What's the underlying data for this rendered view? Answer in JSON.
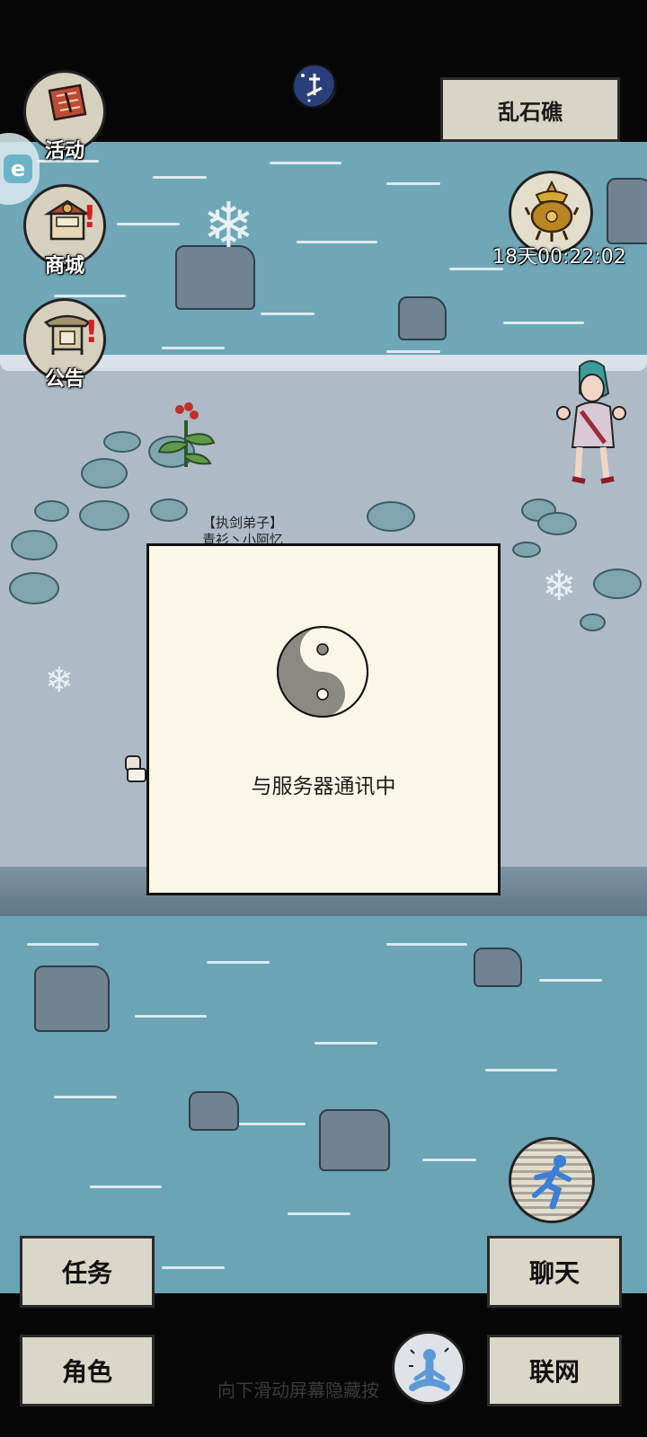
{
  "location": {
    "label": "乱石礁"
  },
  "side_menu": [
    {
      "label": "活动",
      "icon": "scroll-icon",
      "alert": false
    },
    {
      "label": "商城",
      "icon": "shop-icon",
      "alert": true
    },
    {
      "label": "公告",
      "icon": "notice-board-icon",
      "alert": true
    }
  ],
  "event": {
    "icon": "golden-censer-icon",
    "countdown": "18天00:22:02"
  },
  "npc": {
    "title": "【执剑弟子】",
    "name": "青衫丶小阿忆"
  },
  "modal": {
    "icon": "yin-yang-icon",
    "message": "与服务器通讯中"
  },
  "buttons": {
    "task": "任务",
    "chat": "聊天",
    "role": "角色",
    "network": "联网"
  },
  "hint": "向下滑动屏幕隐藏按",
  "colors": {
    "water": "#6fa7b7",
    "ground": "#aebbc7",
    "modal_bg": "#fbf7e8",
    "alert": "#d21f1f"
  }
}
